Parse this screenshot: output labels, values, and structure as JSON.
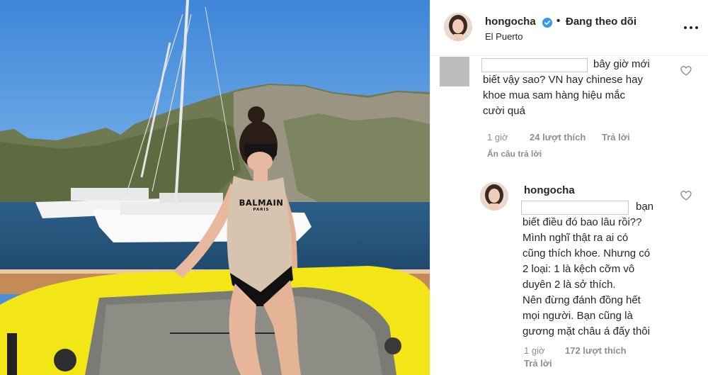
{
  "photo": {
    "alt": "Woman in BALMAIN swimsuit on a boat with sailboats and hills behind",
    "shirt_logo": "BALMAIN",
    "shirt_logo_sub": "PARIS"
  },
  "header": {
    "username": "hongocha",
    "separator": "•",
    "follow_status": "Đang theo dõi",
    "location": "El Puerto"
  },
  "comments": [
    {
      "text_lines": [
        "bây giờ mới",
        "biết vậy sao? VN hay chinese hay",
        "khoe mua sam hàng hiệu mắc",
        "cười quá"
      ],
      "time": "1 giờ",
      "likes": "24 lượt thích",
      "reply_label": "Trả lời",
      "hide_replies_label": "Ẩn câu trả lời"
    }
  ],
  "reply": {
    "username": "hongocha",
    "text_lines": [
      "bạn",
      "biết điều đó bao lâu rồi??",
      "Mình nghĩ thật ra ai có",
      "cũng thích khoe. Nhưng có",
      "2 loại: 1 là kệch cỡm vô",
      "duyên 2 là sở thích.",
      "Nên đừng đánh đồng hết",
      "mọi người. Bạn cũng là",
      "gương mặt châu á đấy thôi"
    ],
    "time": "1 giờ",
    "likes": "172 lượt thích",
    "reply_label": "Trả lời"
  },
  "colors": {
    "text": "#262626",
    "secondary": "#8e8e8e",
    "verified": "#3897f0",
    "border": "#efefef",
    "board_yellow": "#f2e617"
  },
  "icons": [
    "verified-badge-icon",
    "more-options-icon",
    "heart-icon"
  ]
}
